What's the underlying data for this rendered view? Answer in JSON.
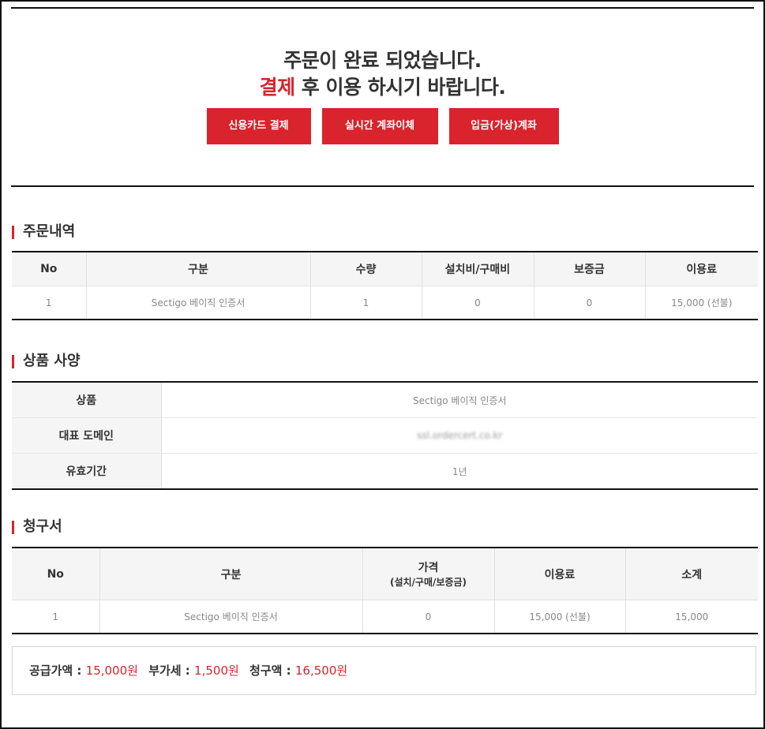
{
  "headline": {
    "line1": "주문이 완료 되었습니다.",
    "line2_red": "결제",
    "line2_rest": " 후 이용 하시기 바랍니다."
  },
  "payment_buttons": [
    {
      "label": "신용카드 결제"
    },
    {
      "label": "실시간 계좌이체"
    },
    {
      "label": "입금(가상)계좌"
    }
  ],
  "order": {
    "title": "주문내역",
    "headers": [
      "No",
      "구분",
      "수량",
      "설치비/구매비",
      "보증금",
      "이용료"
    ],
    "row": [
      "1",
      "Sectigo 베이직 인증서",
      "1",
      "0",
      "0",
      "15,000 (선불)"
    ]
  },
  "spec": {
    "title": "상품 사양",
    "rows": [
      {
        "key": "상품",
        "value": "Sectigo 베이직 인증서"
      },
      {
        "key": "대표 도메인",
        "value": "ssl.ordercert.co.kr"
      },
      {
        "key": "유효기간",
        "value": "1년"
      }
    ]
  },
  "invoice": {
    "title": "청구서",
    "headers": [
      "No",
      "구분",
      "가격",
      "(설치/구매/보증금)",
      "이용료",
      "소계"
    ],
    "row": [
      "1",
      "Sectigo 베이직 인증서",
      "0",
      "15,000 (선불)",
      "15,000"
    ]
  },
  "summary": {
    "supply_label": "공급가액 :",
    "supply_value": "15,000원",
    "vat_label": "부가세 :",
    "vat_value": "1,500원",
    "total_label": "청구액 :",
    "total_value": "16,500원"
  },
  "colors": {
    "accent": "#d9232d",
    "border": "#111111",
    "header_bg": "#f5f5f5"
  }
}
